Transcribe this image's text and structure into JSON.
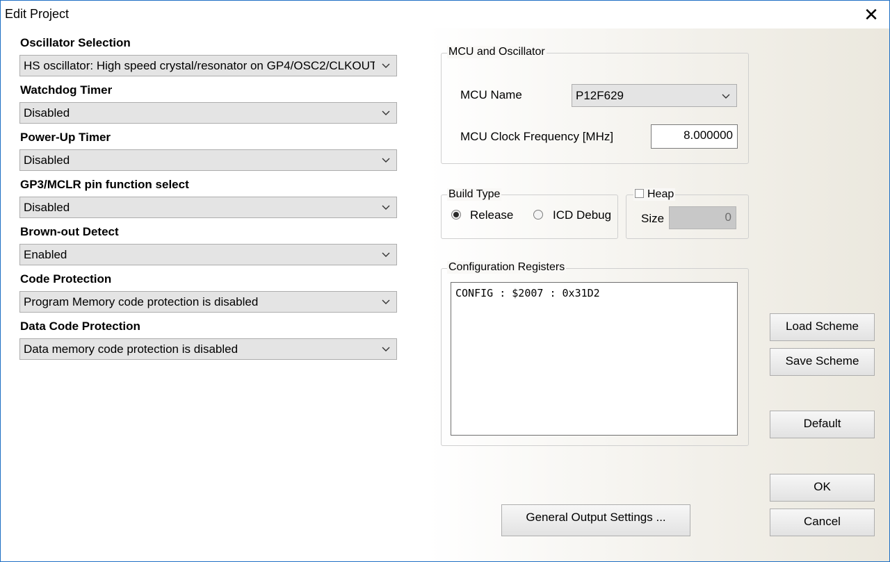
{
  "window": {
    "title": "Edit Project",
    "close_glyph": "✕"
  },
  "config_fields": [
    {
      "label": "Oscillator Selection",
      "value": "HS oscillator: High speed crystal/resonator on GP4/OSC2/CLKOUT"
    },
    {
      "label": "Watchdog Timer",
      "value": "Disabled"
    },
    {
      "label": "Power-Up Timer",
      "value": "Disabled"
    },
    {
      "label": "GP3/MCLR pin function select",
      "value": "Disabled"
    },
    {
      "label": "Brown-out Detect",
      "value": "Enabled"
    },
    {
      "label": "Code Protection",
      "value": "Program Memory code protection is disabled"
    },
    {
      "label": "Data Code Protection",
      "value": "Data memory code protection is disabled"
    }
  ],
  "mcu_group": {
    "title": "MCU and Oscillator",
    "mcu_name_label": "MCU Name",
    "mcu_name_value": "P12F629",
    "clock_label": "MCU Clock Frequency [MHz]",
    "clock_value": "8.000000"
  },
  "build_group": {
    "title": "Build Type",
    "release_label": "Release",
    "debug_label": "ICD Debug",
    "selected": "Release"
  },
  "heap_group": {
    "title": "Heap",
    "checked": false,
    "size_label": "Size",
    "size_value": "0"
  },
  "config_registers": {
    "title": "Configuration Registers",
    "text": "CONFIG : $2007 : 0x31D2"
  },
  "buttons": {
    "general_output": "General Output Settings ...",
    "load_scheme": "Load Scheme",
    "save_scheme": "Save Scheme",
    "default": "Default",
    "ok": "OK",
    "cancel": "Cancel"
  }
}
